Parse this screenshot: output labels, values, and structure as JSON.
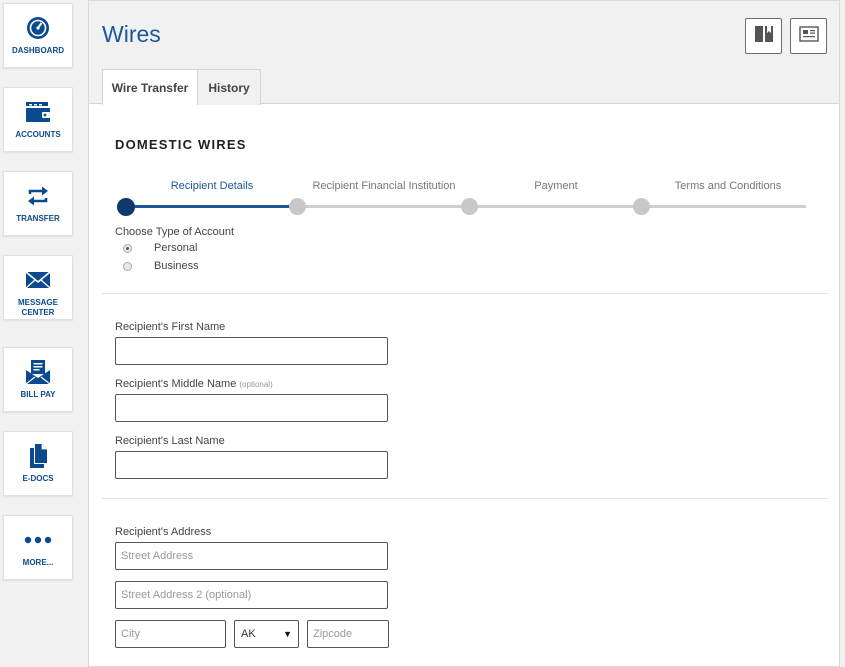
{
  "sidebar": {
    "items": [
      {
        "label": "DASHBOARD",
        "icon": "gauge-icon"
      },
      {
        "label": "ACCOUNTS",
        "icon": "wallet-icon"
      },
      {
        "label": "TRANSFER",
        "icon": "transfer-arrows-icon"
      },
      {
        "label": "MESSAGE CENTER",
        "icon": "envelope-icon"
      },
      {
        "label": "BILL PAY",
        "icon": "bill-envelope-icon"
      },
      {
        "label": "E-DOCS",
        "icon": "documents-icon"
      },
      {
        "label": "MORE...",
        "icon": "ellipsis-icon"
      }
    ]
  },
  "header": {
    "title": "Wires",
    "buttons": [
      {
        "icon": "bookmark-book-icon"
      },
      {
        "icon": "newspaper-icon"
      }
    ]
  },
  "tabs": [
    {
      "label": "Wire Transfer",
      "active": true
    },
    {
      "label": "History",
      "active": false
    }
  ],
  "form": {
    "section_title": "DOMESTIC WIRES",
    "steps": [
      {
        "label": "Recipient Details",
        "active": true
      },
      {
        "label": "Recipient Financial Institution",
        "active": false
      },
      {
        "label": "Payment",
        "active": false
      },
      {
        "label": "Terms and Conditions",
        "active": false
      }
    ],
    "account_type": {
      "label": "Choose Type of Account",
      "options": [
        {
          "label": "Personal",
          "checked": true
        },
        {
          "label": "Business",
          "checked": false
        }
      ]
    },
    "first_name": {
      "label": "Recipient's First Name",
      "value": ""
    },
    "middle_name": {
      "label": "Recipient's Middle Name",
      "optional": "(optional)",
      "value": ""
    },
    "last_name": {
      "label": "Recipient's Last Name",
      "value": ""
    },
    "address": {
      "label": "Recipient's Address",
      "street_placeholder": "Street Address",
      "street2_placeholder": "Street Address 2 (optional)",
      "city_placeholder": "City",
      "state_value": "AK",
      "zip_placeholder": "Zipcode"
    }
  },
  "colors": {
    "brand_blue": "#1d5797",
    "nav_blue": "#0b4a8f",
    "step_active_dot": "#0e3a6b",
    "step_inactive": "#c8c8c8"
  }
}
